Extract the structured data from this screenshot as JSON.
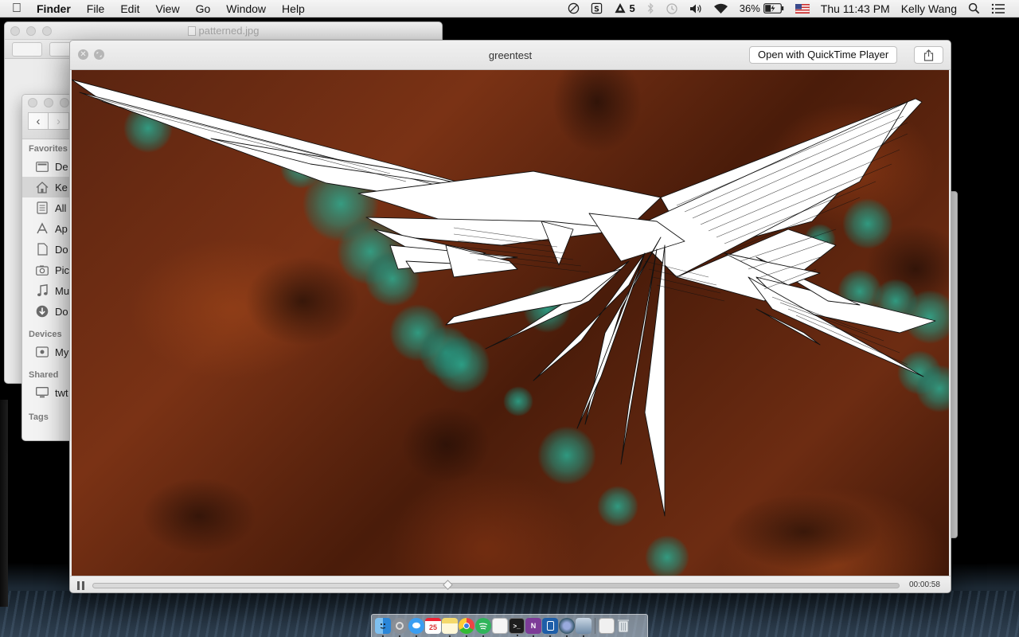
{
  "menubar": {
    "app_name": "Finder",
    "menus": [
      "File",
      "Edit",
      "View",
      "Go",
      "Window",
      "Help"
    ],
    "adobe_count": "5",
    "battery_percent": "36%",
    "clock": "Thu 11:43 PM",
    "user": "Kelly Wang"
  },
  "preview_window": {
    "title": "patterned.jpg"
  },
  "finder": {
    "favorites_heading": "Favorites",
    "favorites": [
      {
        "label": "De",
        "icon": "desktop-icon"
      },
      {
        "label": "Ke",
        "icon": "home-icon"
      },
      {
        "label": "All",
        "icon": "all-files-icon"
      },
      {
        "label": "Ap",
        "icon": "applications-icon"
      },
      {
        "label": "Do",
        "icon": "documents-icon"
      },
      {
        "label": "Pic",
        "icon": "pictures-icon"
      },
      {
        "label": "Mu",
        "icon": "music-icon"
      },
      {
        "label": "Do",
        "icon": "downloads-icon"
      }
    ],
    "devices_heading": "Devices",
    "devices": [
      {
        "label": "My",
        "icon": "disk-icon"
      }
    ],
    "shared_heading": "Shared",
    "shared": [
      {
        "label": "twt",
        "icon": "monitor-icon"
      }
    ],
    "tags_heading": "Tags"
  },
  "quicklook": {
    "title": "greentest",
    "open_button": "Open with QuickTime Player",
    "time": "00:00:58",
    "progress": 0.44
  },
  "colors": {
    "bokeh_teal": "#1e9a86",
    "background_brown": "#6d2c12"
  },
  "dock": {
    "items": [
      "finder-icon",
      "system-preferences-icon",
      "messages-icon",
      "calendar-icon",
      "notes-icon",
      "chrome-icon",
      "spotify-icon",
      "textedit-icon",
      "terminal-icon",
      "onenote-icon",
      "simulator-icon",
      "quicktime-icon",
      "preview-icon",
      "documents-folder-icon",
      "trash-icon"
    ],
    "calendar_day": "25"
  }
}
